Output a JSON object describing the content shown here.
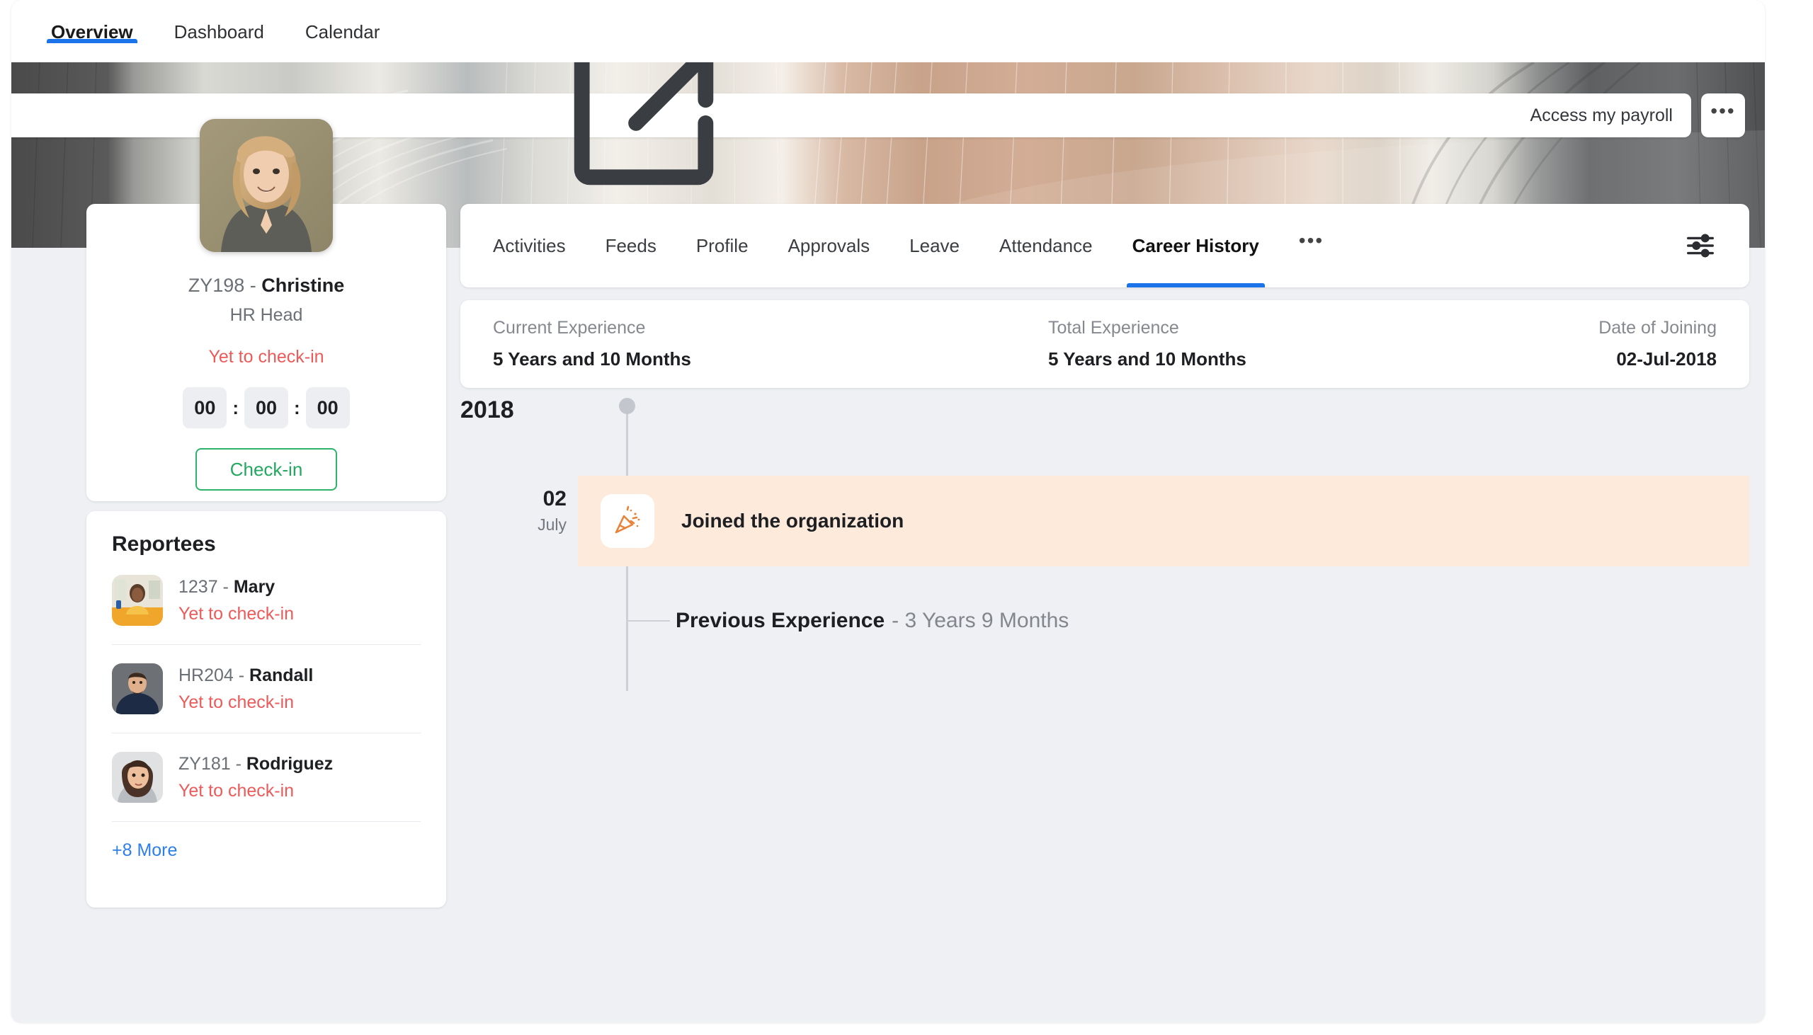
{
  "top_tabs": [
    {
      "label": "Overview",
      "active": true
    },
    {
      "label": "Dashboard",
      "active": false
    },
    {
      "label": "Calendar",
      "active": false
    }
  ],
  "banner": {
    "payroll_button": "Access my payroll",
    "more_button": "•••",
    "external_link_icon": "external-link-icon"
  },
  "profile": {
    "employee_id": "ZY198 - ",
    "name": "Christine",
    "role": "HR Head",
    "status": "Yet to check-in",
    "timer": {
      "hours": "00",
      "minutes": "00",
      "seconds": "00",
      "separator": ":"
    },
    "checkin_label": "Check-in"
  },
  "reportees": {
    "title": "Reportees",
    "items": [
      {
        "id": "1237 - ",
        "name": "Mary",
        "status": "Yet to check-in"
      },
      {
        "id": "HR204 - ",
        "name": "Randall",
        "status": "Yet to check-in"
      },
      {
        "id": "ZY181 - ",
        "name": "Rodriguez",
        "status": "Yet to check-in"
      }
    ],
    "more_link": "+8 More"
  },
  "inner_tabs": [
    {
      "label": "Activities",
      "active": false
    },
    {
      "label": "Feeds",
      "active": false
    },
    {
      "label": "Profile",
      "active": false
    },
    {
      "label": "Approvals",
      "active": false
    },
    {
      "label": "Leave",
      "active": false
    },
    {
      "label": "Attendance",
      "active": false
    },
    {
      "label": "Career History",
      "active": true
    }
  ],
  "inner_tabs_overflow": "•••",
  "summary": {
    "current_experience_label": "Current Experience",
    "current_experience_value": "5 Years and 10 Months",
    "total_experience_label": "Total Experience",
    "total_experience_value": "5 Years and 10 Months",
    "date_of_joining_label": "Date of Joining",
    "date_of_joining_value": "02-Jul-2018"
  },
  "timeline": {
    "year": "2018",
    "event_day": "02",
    "event_month": "July",
    "event_title": "Joined the organization",
    "event_icon": "party-popper-icon",
    "previous_experience_label": "Previous Experience",
    "previous_experience_separator": " - ",
    "previous_experience_duration": "3 Years 9 Months"
  },
  "colors": {
    "accent_blue": "#1a73e8",
    "status_red": "#ec5a5a",
    "checkin_green": "#22a95f",
    "event_peach": "#fdeada",
    "link_blue": "#2f7fe8",
    "page_bg": "#eef0f4"
  }
}
